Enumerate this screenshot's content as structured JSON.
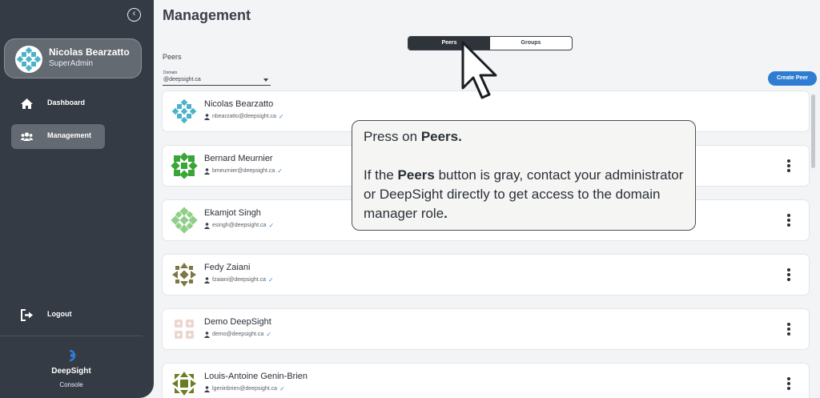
{
  "sidebar": {
    "user": {
      "name": "Nicolas Bearzatto",
      "role": "SuperAdmin"
    },
    "nav": [
      {
        "label": "Dashboard",
        "icon": "home-icon"
      },
      {
        "label": "Management",
        "icon": "users-icon"
      }
    ],
    "logout_label": "Logout",
    "brand": {
      "name": "DeepSight",
      "sub": "Console"
    }
  },
  "main": {
    "title": "Management",
    "toggle": {
      "peers": "Peers",
      "groups": "Groups"
    },
    "section_label": "Peers",
    "domain": {
      "label": "Domain",
      "value": "@deepsight.ca"
    },
    "create_button": "Create Peer",
    "peers": [
      {
        "name": "Nicolas Bearzatto",
        "email": "nbearzatto@deepsight.ca"
      },
      {
        "name": "Bernard Meurnier",
        "email": "bmeurnier@deepsight.ca"
      },
      {
        "name": "Ekamjot Singh",
        "email": "esingh@deepsight.ca"
      },
      {
        "name": "Fedy Zaiani",
        "email": "fzaiani@deepsight.ca"
      },
      {
        "name": "Demo DeepSight",
        "email": "demo@deepsight.ca"
      },
      {
        "name": "Louis-Antoine Genin-Brien",
        "email": "lgeninbrien@deepsight.ca"
      }
    ]
  },
  "callout": {
    "line1_pre": "Press on ",
    "line1_bold": "Peers.",
    "line2_pre": "If the ",
    "line2_bold": "Peers",
    "line2_post": " button is gray, contact your administrator or DeepSight directly to get access to the domain manager role",
    "line2_end": "."
  },
  "colors": {
    "accent": "#2f7dd3",
    "sidebar": "#353b45",
    "active": "#646a72"
  }
}
